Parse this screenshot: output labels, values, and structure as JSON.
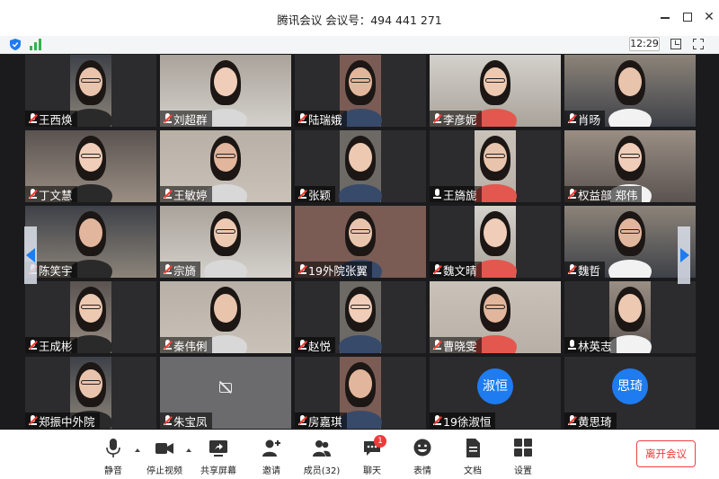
{
  "window": {
    "title": "腾讯会议 会议号：494 441 271"
  },
  "infobar": {
    "time": "12:29",
    "colors": {
      "shield": "#1e7cf0",
      "signal": "#2fb450"
    }
  },
  "participants": [
    {
      "name": "王西焕",
      "muted": true
    },
    {
      "name": "刘超群",
      "muted": true
    },
    {
      "name": "陆瑞娥",
      "muted": true
    },
    {
      "name": "李彦妮",
      "muted": true
    },
    {
      "name": "肖旸",
      "muted": true
    },
    {
      "name": "丁文慧",
      "muted": true
    },
    {
      "name": "王敏婷",
      "muted": true
    },
    {
      "name": "张颖",
      "muted": true
    },
    {
      "name": "王旖旎",
      "muted": false
    },
    {
      "name": "权益部 郑伟",
      "muted": true
    },
    {
      "name": "陈笑宇",
      "muted": true
    },
    {
      "name": "宗旖",
      "muted": true
    },
    {
      "name": "19外院张翼",
      "muted": true
    },
    {
      "name": "魏文晴",
      "muted": true
    },
    {
      "name": "魏哲",
      "muted": true
    },
    {
      "name": "王成彬",
      "muted": true
    },
    {
      "name": "秦伟俐",
      "muted": true
    },
    {
      "name": "赵悦",
      "muted": true
    },
    {
      "name": "曹晓雯",
      "muted": true
    },
    {
      "name": "林英志",
      "muted": false
    },
    {
      "name": "郑振中外院",
      "muted": true
    },
    {
      "name": "朱宝凤",
      "muted": true
    },
    {
      "name": "房嘉琪",
      "muted": true
    },
    {
      "name": "19徐淑恒",
      "muted": true,
      "avatar": "淑恒"
    },
    {
      "name": "黄思琦",
      "muted": true,
      "avatar": "思琦"
    }
  ],
  "toolbar": {
    "mute_label": "静音",
    "stop_video_label": "停止视频",
    "share_screen_label": "共享屏幕",
    "invite_label": "邀请",
    "members_label": "成员(32)",
    "chat_label": "聊天",
    "chat_badge": "1",
    "reactions_label": "表情",
    "docs_label": "文档",
    "settings_label": "设置",
    "leave_label": "离开会议"
  },
  "colors": {
    "accent": "#1e7cf0",
    "leave": "#f03a3a",
    "badge": "#f03a3a"
  }
}
